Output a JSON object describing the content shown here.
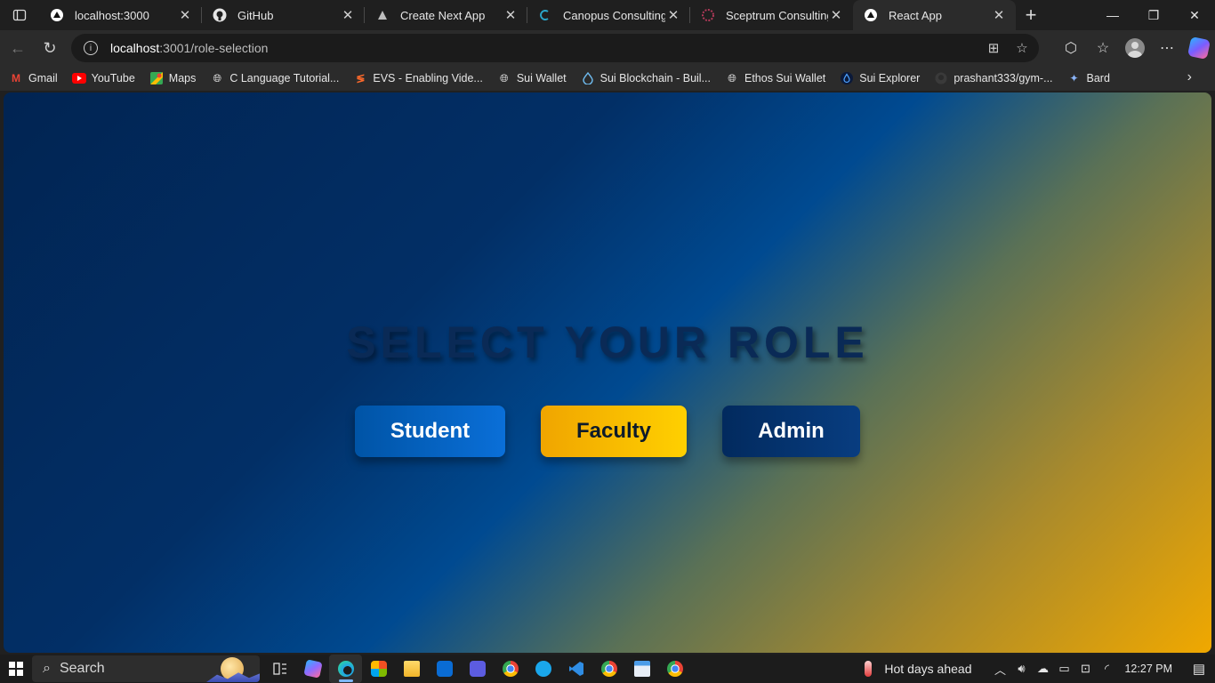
{
  "browser": {
    "tabs": [
      {
        "title": "localhost:3000",
        "icon": "nextjs-icon",
        "active": false
      },
      {
        "title": "GitHub",
        "icon": "github-icon",
        "active": false
      },
      {
        "title": "Create Next App",
        "icon": "nextjs-icon",
        "active": false
      },
      {
        "title": "Canopus Consulting",
        "icon": "canopus-icon",
        "active": false
      },
      {
        "title": "Sceptrum Consulting",
        "icon": "sceptrum-icon",
        "active": false
      },
      {
        "title": "React App",
        "icon": "nextjs-icon",
        "active": true
      }
    ],
    "address": {
      "host": "localhost",
      "path": ":3001/role-selection"
    },
    "bookmarks": [
      {
        "label": "Gmail",
        "icon": "gmail-icon",
        "color": "#ea4335"
      },
      {
        "label": "YouTube",
        "icon": "youtube-icon",
        "color": "#ff0000"
      },
      {
        "label": "Maps",
        "icon": "maps-icon",
        "color": "#34a853"
      },
      {
        "label": "C Language Tutorial...",
        "icon": "globe-icon",
        "color": "#cfcfcf"
      },
      {
        "label": "EVS - Enabling Vide...",
        "icon": "evs-icon",
        "color": "#ff6a2b"
      },
      {
        "label": "Sui Wallet",
        "icon": "globe-icon",
        "color": "#cfcfcf"
      },
      {
        "label": "Sui Blockchain - Buil...",
        "icon": "sui-drop-icon",
        "color": "#6fbcf0"
      },
      {
        "label": "Ethos Sui Wallet",
        "icon": "globe-icon",
        "color": "#cfcfcf"
      },
      {
        "label": "Sui Explorer",
        "icon": "sui-drop-icon",
        "color": "#4da2ff"
      },
      {
        "label": "prashant333/gym-...",
        "icon": "github-icon",
        "color": "#cfcfcf"
      },
      {
        "label": "Bard",
        "icon": "bard-icon",
        "color": "#8ab4f8"
      }
    ]
  },
  "page": {
    "heading": "SELECT YOUR ROLE",
    "buttons": {
      "student": "Student",
      "faculty": "Faculty",
      "admin": "Admin"
    }
  },
  "taskbar": {
    "search_placeholder": "Search",
    "weather": "Hot days ahead",
    "time": "12:27 PM",
    "apps": [
      {
        "name": "task-view-icon",
        "color": "#dcdcdc"
      },
      {
        "name": "copilot-icon",
        "color": "#8f6bff"
      },
      {
        "name": "edge-icon",
        "color": "#1fa3e8"
      },
      {
        "name": "store-icon",
        "color": "#3a8ee6"
      },
      {
        "name": "file-explorer-icon",
        "color": "#f5c542"
      },
      {
        "name": "outlook-icon",
        "color": "#0a6cd4"
      },
      {
        "name": "visual-studio-icon",
        "color": "#5c5ce0"
      },
      {
        "name": "chrome-icon",
        "color": "#e8453c"
      },
      {
        "name": "c-app-icon",
        "color": "#1aa7ec"
      },
      {
        "name": "vscode-icon",
        "color": "#2f8de4"
      },
      {
        "name": "chrome-icon-2",
        "color": "#e8453c"
      },
      {
        "name": "window-app-icon",
        "color": "#4c9ce8"
      },
      {
        "name": "chrome-icon-3",
        "color": "#e8453c"
      }
    ]
  }
}
